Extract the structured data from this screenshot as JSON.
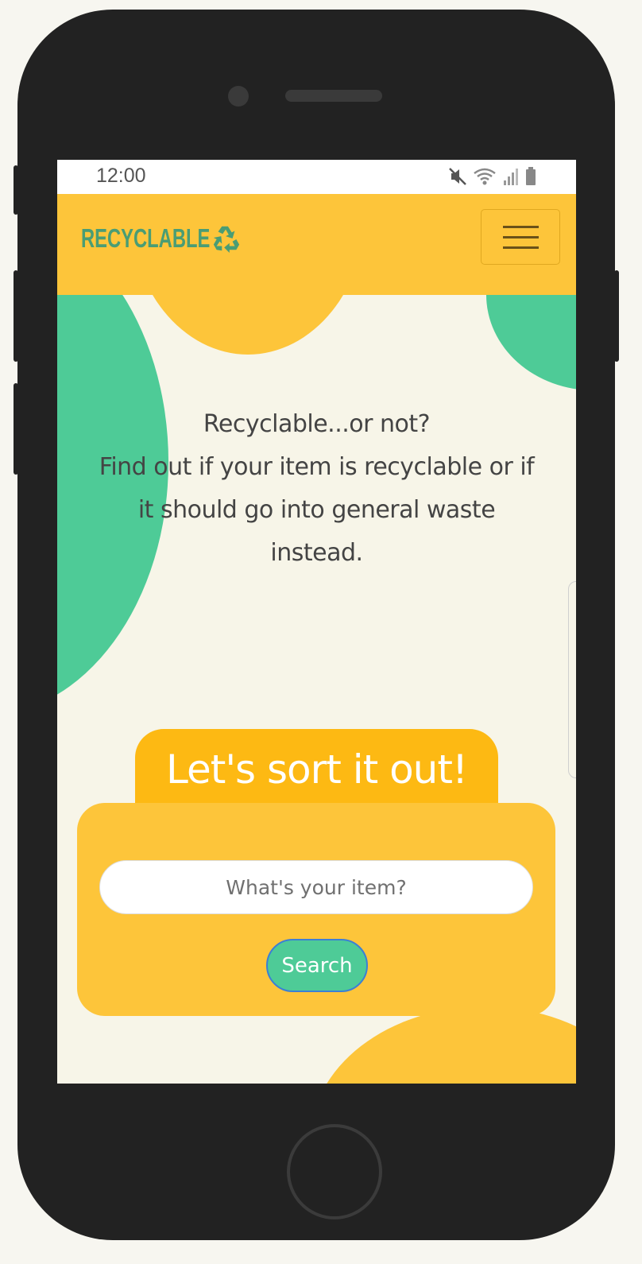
{
  "status_bar": {
    "time": "12:00",
    "icons": [
      "mute-icon",
      "wifi-icon",
      "signal-icon",
      "battery-icon"
    ]
  },
  "navbar": {
    "brand_text": "RECYCLABLE",
    "brand_icon": "recycle-icon",
    "menu_icon": "hamburger-menu-icon"
  },
  "hero": {
    "line1": "Recyclable...or not?",
    "line2": "Find out if your item is recyclable or if it should go into general waste instead."
  },
  "search_card": {
    "title": "Let's sort it out!",
    "input_placeholder": "What's your item?",
    "button_label": "Search"
  },
  "colors": {
    "primary_yellow": "#fdc53a",
    "tab_yellow": "#fdb913",
    "green": "#4ecb97",
    "brand_green": "#4a9d74",
    "background": "#f7f5e8"
  }
}
